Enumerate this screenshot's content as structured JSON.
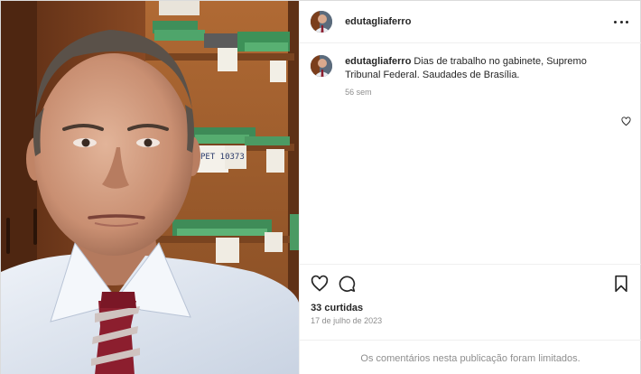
{
  "post": {
    "username": "edutagliaferro",
    "caption": {
      "username": "edutagliaferro",
      "text": "Dias de trabalho no gabinete, Supremo Tribunal Federal. Saudades de Brasília.",
      "time_ago": "56 sem"
    },
    "photo": {
      "folder_label": "PET 10373"
    },
    "icons": {
      "more": "more-horizontal-icon",
      "caption_like": "heart-icon",
      "like": "heart-icon",
      "comment": "comment-icon",
      "save": "bookmark-icon"
    },
    "likes": "33 curtidas",
    "date": "17 de julho de 2023",
    "comments_disabled": "Os comentários nesta publicação foram limitados."
  }
}
